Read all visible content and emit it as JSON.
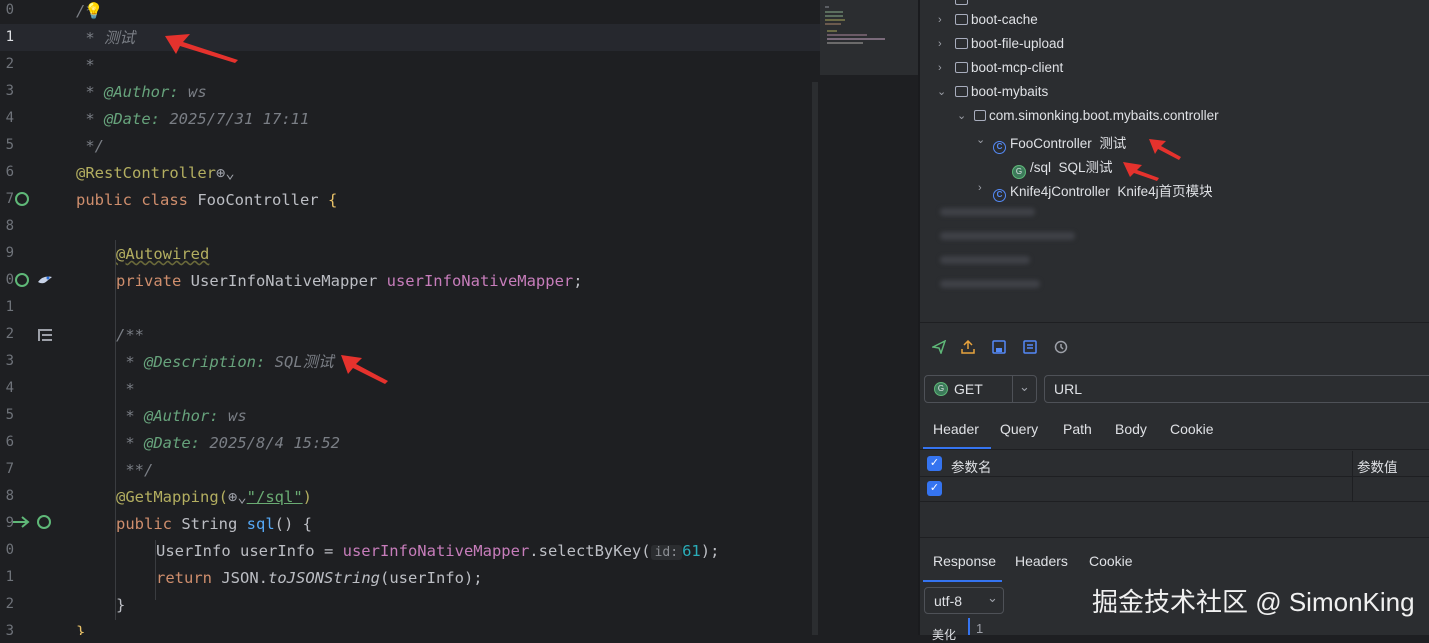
{
  "editor": {
    "line_numbers": [
      "0",
      "1",
      "2",
      "3",
      "4",
      "5",
      "6",
      "7",
      "8",
      "9",
      "0",
      "1",
      "2",
      "3",
      "4",
      "5",
      "6",
      "7",
      "8",
      "9",
      "0",
      "1",
      "2",
      "3"
    ],
    "code": {
      "l0": "/*",
      "l1_star": " * ",
      "l1_text": "测试",
      "l2": " *",
      "l3_star": " * ",
      "l3_tag": "@Author:",
      "l3_val": " ws",
      "l4_star": " * ",
      "l4_tag": "@Date:",
      "l4_val": " 2025/7/31 17:11",
      "l5": " */",
      "l6_anno": "@RestController",
      "l7_kw": "public class ",
      "l7_name": "FooController ",
      "l7_brace": "{",
      "l9_anno": "@Autowired",
      "l10_kw": "private ",
      "l10_type": "UserInfoNativeMapper ",
      "l10_field": "userInfoNativeMapper",
      "l10_end": ";",
      "l12": "/**",
      "l13_star": " * ",
      "l13_tag": "@Description:",
      "l13_val": " SQL测试",
      "l14": " *",
      "l15_star": " * ",
      "l15_tag": "@Author:",
      "l15_val": " ws",
      "l16_star": " * ",
      "l16_tag": "@Date:",
      "l16_val": " 2025/8/4 15:52",
      "l17": " **/",
      "l18_anno": "@GetMapping(",
      "l18_str": "\"/sql\"",
      "l18_end": ")",
      "l19_kw": "public ",
      "l19_type": "String ",
      "l19_fn": "sql",
      "l19_end": "() {",
      "l20_a": "UserInfo userInfo = ",
      "l20_field": "userInfoNativeMapper",
      "l20_b": ".selectByKey(",
      "l20_hint": "id:",
      "l20_num": "61",
      "l20_c": ");",
      "l21_a": "return ",
      "l21_b": "JSON.",
      "l21_fn": "toJSONString",
      "l21_c": "(userInfo);",
      "l22": "}",
      "l23": "}"
    }
  },
  "tree": {
    "items": [
      {
        "label": "boot-cache"
      },
      {
        "label": "boot-file-upload"
      },
      {
        "label": "boot-mcp-client"
      },
      {
        "label": "boot-mybaits"
      },
      {
        "label": "com.simonking.boot.mybaits.controller"
      },
      {
        "label": "FooController",
        "desc": "测试"
      },
      {
        "label": "/sql",
        "desc": "SQL测试"
      },
      {
        "label": "Knife4jController",
        "desc": "Knife4j首页模块"
      }
    ]
  },
  "request": {
    "method": "GET",
    "url_placeholder": "URL",
    "tabs": [
      "Header",
      "Query",
      "Path",
      "Body",
      "Cookie"
    ],
    "table_headers": [
      "参数名",
      "参数值"
    ]
  },
  "response": {
    "tabs": [
      "Response",
      "Headers",
      "Cookie"
    ],
    "encoding": "utf-8",
    "line_number": "1",
    "partial_label": "美化"
  },
  "watermark": "掘金技术社区 @ SimonKing",
  "colors": {
    "editor_bg": "#1e1f22",
    "panel_bg": "#2b2d30",
    "accent": "#3574f0",
    "arrow": "#e5322d"
  }
}
